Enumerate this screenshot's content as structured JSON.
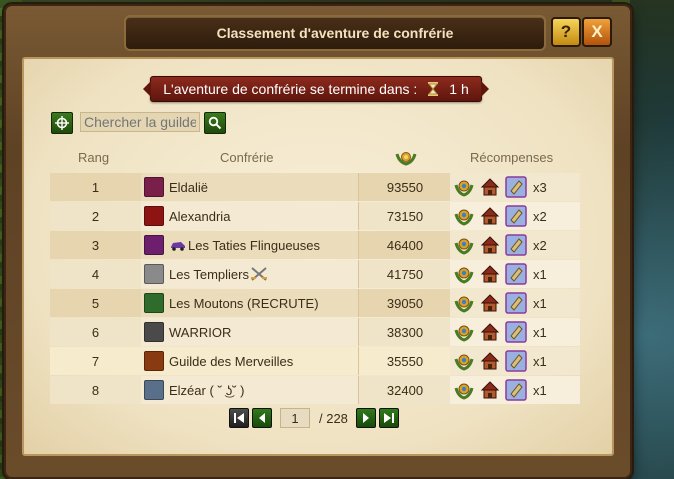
{
  "window": {
    "title": "Classement d'aventure de confrérie",
    "help_label": "?",
    "close_label": "X"
  },
  "banner": {
    "text": "L'aventure de confrérie se termine dans :",
    "time": "1 h"
  },
  "search": {
    "placeholder": "Chercher la guilde"
  },
  "table": {
    "headers": {
      "rank": "Rang",
      "guild": "Confrérie",
      "score_icon": "laurel-trophy-icon",
      "rewards": "Récompenses"
    },
    "rows": [
      {
        "rank": "1",
        "name": "Eldalië",
        "name_extra": "",
        "score": "93550",
        "multiplier": "x3",
        "crest_color": "#7a1f4a"
      },
      {
        "rank": "2",
        "name": "Alexandria",
        "name_extra": "",
        "score": "73150",
        "multiplier": "x2",
        "crest_color": "#8e1414"
      },
      {
        "rank": "3",
        "name": "Les Taties Flingueuses",
        "name_extra": "",
        "score": "46400",
        "multiplier": "x2",
        "crest_color": "#6d1f6d"
      },
      {
        "rank": "4",
        "name": "Les Templiers",
        "name_extra": "",
        "score": "41750",
        "multiplier": "x1",
        "crest_color": "#8a8a8a"
      },
      {
        "rank": "5",
        "name": "Les Moutons (RECRUTE)",
        "name_extra": "",
        "score": "39050",
        "multiplier": "x1",
        "crest_color": "#2f6b2a"
      },
      {
        "rank": "6",
        "name": "WARRIOR",
        "name_extra": "",
        "score": "38300",
        "multiplier": "x1",
        "crest_color": "#4a4a4a"
      },
      {
        "rank": "7",
        "name": "Guilde des Merveilles",
        "name_extra": "",
        "score": "35550",
        "multiplier": "x1",
        "crest_color": "#8a3a10"
      },
      {
        "rank": "8",
        "name": "Elzéar (",
        "name_extra": "˘ ͜ʖ˘ )",
        "score": "32400",
        "multiplier": "x1",
        "crest_color": "#5a6f8a"
      }
    ],
    "reward_icons": [
      "guild-goods-icon",
      "forge-house-icon",
      "diplomacy-scroll-icon"
    ]
  },
  "pager": {
    "current": "1",
    "total": "/ 228"
  },
  "colors": {
    "banner": "#7a2216",
    "parchment": "#f3e8cf",
    "green_button": "#2f7a1c"
  }
}
